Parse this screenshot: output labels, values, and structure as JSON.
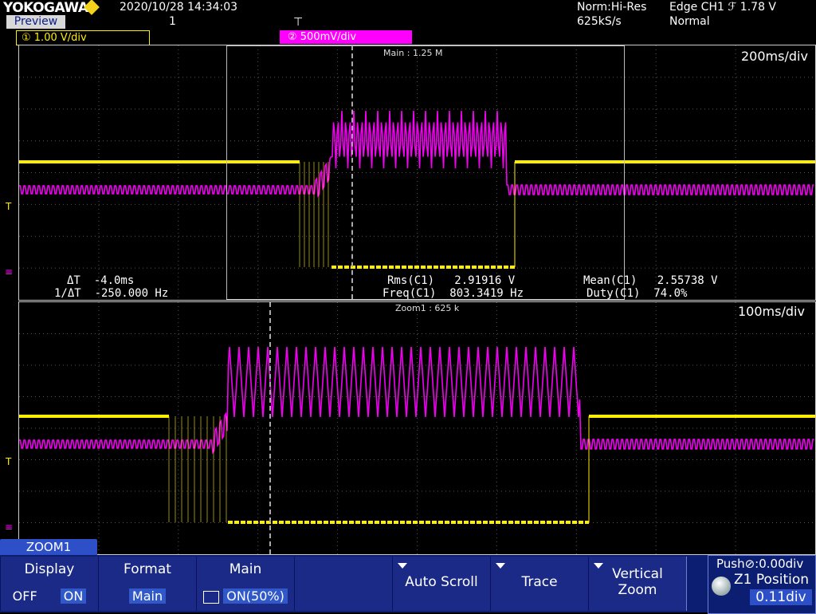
{
  "header": {
    "brand": "YOKOGAWA",
    "preview": "Preview",
    "datetime": "2020/10/28  14:34:03",
    "acq_count": "1",
    "acq_mode": "Norm:Hi-Res",
    "sample_rate": "625kS/s",
    "trigger": "Edge CH1  ℱ 1.78 V",
    "trigger_mode": "Normal"
  },
  "channels": {
    "ch1": {
      "label": "① 1.00 V/div",
      "color": "#ffee00"
    },
    "ch2": {
      "label": "② 500mV/div",
      "color": "#ff00ff"
    }
  },
  "main": {
    "zoom_label": "Main : 1.25 M",
    "timebase": "200ms/div",
    "measurements": {
      "dt": "ΔT  -4.0ms",
      "inv_dt": "1/ΔT  -250.000 Hz",
      "rms": "Rms(C1)   2.91916 V",
      "freq": "Freq(C1)  803.3419 Hz",
      "mean": "Mean(C1)   2.55738 V",
      "duty": "Duty(C1)  74.0%"
    }
  },
  "zoom": {
    "zoom_label": "Zoom1 : 625 k",
    "timebase": "100ms/div"
  },
  "markers": {
    "trigger_level": "T",
    "ground": "≡"
  },
  "menu": {
    "tab": "ZOOM1",
    "display": {
      "title": "Display",
      "off": "OFF",
      "on": "ON"
    },
    "format": {
      "title": "Format",
      "value": "Main"
    },
    "mainkey": {
      "title": "Main",
      "value": "ON(50%)"
    },
    "auto_scroll": "Auto Scroll",
    "trace": "Trace",
    "vertical_zoom_1": "Vertical",
    "vertical_zoom_2": "Zoom",
    "push": "Push⊘:0.00div",
    "z1_position": "Z1 Position",
    "z1_value": "0.11div"
  },
  "colors": {
    "ch1": "#ffee00",
    "ch2": "#ff00ff",
    "grid": "#555555",
    "menu_bg": "#0b1e72"
  }
}
